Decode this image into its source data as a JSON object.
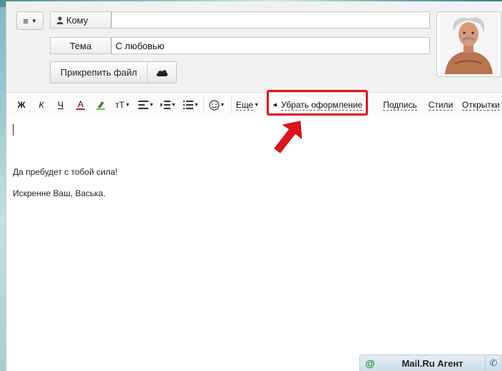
{
  "compose": {
    "to_label": "Кому",
    "to_value": "",
    "subject_label": "Тема",
    "subject_value": "С любовью",
    "attach_label": "Прикрепить файл"
  },
  "toolbar": {
    "bold": "Ж",
    "italic": "К",
    "underline": "Ч",
    "text_color": "А",
    "font_size": "тТ",
    "more": "Еще",
    "remove_formatting": "Убрать оформление",
    "signature": "Подпись",
    "styles": "Стили",
    "postcards": "Открытки"
  },
  "body": {
    "line1": "Да пребудет с тобой сила!",
    "line2": "Искренне Ваш, Васька."
  },
  "agent": {
    "title": "Mail.Ru Агент"
  },
  "colors": {
    "highlight": "#e0141a",
    "arrow": "#e0141a"
  }
}
